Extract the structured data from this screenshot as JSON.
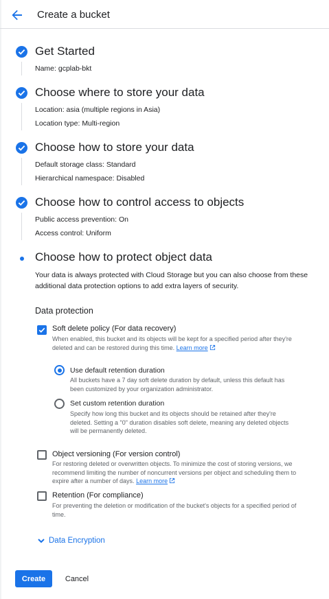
{
  "header": {
    "title": "Create a bucket"
  },
  "steps": [
    {
      "title": "Get Started",
      "details": [
        {
          "key": "Name:",
          "value": "gcplab-bkt"
        }
      ]
    },
    {
      "title": "Choose where to store your data",
      "details": [
        {
          "key": "Location:",
          "value": "asia (multiple regions in Asia)"
        },
        {
          "key": "Location type:",
          "value": "Multi-region"
        }
      ]
    },
    {
      "title": "Choose how to store your data",
      "details": [
        {
          "key": "Default storage class:",
          "value": "Standard"
        },
        {
          "key": "Hierarchical namespace:",
          "value": "Disabled"
        }
      ]
    },
    {
      "title": "Choose how to control access to objects",
      "details": [
        {
          "key": "Public access prevention:",
          "value": "On"
        },
        {
          "key": "Access control:",
          "value": "Uniform"
        }
      ]
    },
    {
      "title": "Choose how to protect object data",
      "description": "Your data is always protected with Cloud Storage but you can also choose from these additional data protection options to add extra layers of security."
    }
  ],
  "protection": {
    "section_title": "Data protection",
    "soft_delete": {
      "label": "Soft delete policy (For data recovery)",
      "checked": true,
      "help": "When enabled, this bucket and its objects will be kept for a specified period after they're deleted and can be restored during this time.",
      "link": "Learn more"
    },
    "retention_options": [
      {
        "label": "Use default retention duration",
        "selected": true,
        "help": "All buckets have a 7 day soft delete duration by default, unless this default has been customized by your organization administrator."
      },
      {
        "label": "Set custom retention duration",
        "selected": false,
        "help": "Specify how long this bucket and its objects should be retained after they're deleted. Setting a \"0\" duration disables soft delete, meaning any deleted objects will be permanently deleted."
      }
    ],
    "versioning": {
      "label": "Object versioning (For version control)",
      "checked": false,
      "help": "For restoring deleted or overwritten objects. To minimize the cost of storing versions, we recommend limiting the number of noncurrent versions per object and scheduling them to expire after a number of days.",
      "link": "Learn more"
    },
    "retention": {
      "label": "Retention (For compliance)",
      "checked": false,
      "help": "For preventing the deletion or modification of the bucket's objects for a specified period of time."
    }
  },
  "encryption": {
    "label": "Data Encryption"
  },
  "actions": {
    "create": "Create",
    "cancel": "Cancel"
  },
  "colors": {
    "accent": "#1a73e8",
    "text": "#202124",
    "muted": "#5f6368",
    "divider": "#dadce0"
  }
}
